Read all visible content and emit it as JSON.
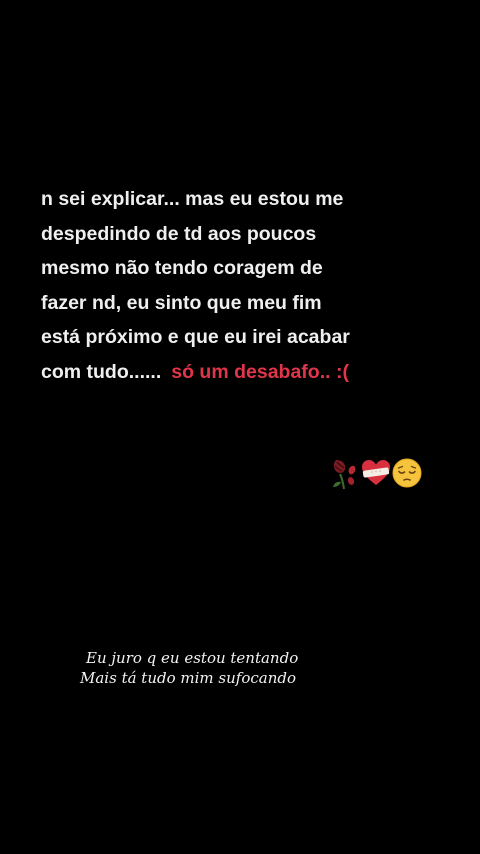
{
  "post": {
    "lines": [
      "n sei explicar... mas eu estou me",
      "despedindo de td aos poucos",
      "mesmo não tendo coragem de",
      "fazer nd, eu sinto que meu fim",
      "está próximo e que eu irei acabar",
      "com tudo......"
    ],
    "highlight": "só um desabafo.. :(",
    "highlight_color": "#e0354a",
    "text_color": "#efefef"
  },
  "emojis": [
    "wilted-rose-icon",
    "bandaged-heart-icon",
    "pensive-face-icon"
  ],
  "caption": {
    "line1": "Eu juro q eu estou tentando",
    "line2": "Mais tá tudo mim sufocando"
  },
  "background": "#000000"
}
